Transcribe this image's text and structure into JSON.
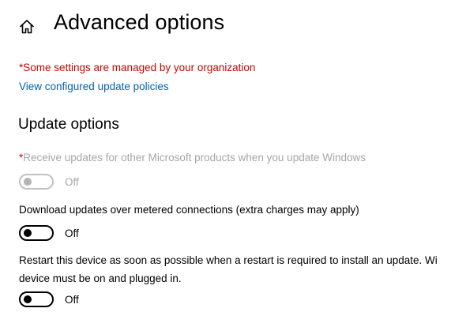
{
  "header": {
    "title": "Advanced options",
    "home_icon": "home-icon"
  },
  "org_notice": {
    "text": "*Some settings are managed by your organization",
    "color": "#c50500"
  },
  "policies_link": {
    "label": "View configured update policies",
    "color": "#0063b1"
  },
  "update_options": {
    "title": "Update options",
    "options": [
      {
        "required_marker": "*",
        "label": "Receive updates for other Microsoft products when you update Windows",
        "state": "Off",
        "enabled": false
      },
      {
        "label": "Download updates over metered connections (extra charges may apply)",
        "state": "Off",
        "enabled": true
      },
      {
        "label": "Restart this device as soon as possible when a restart is required to install an update. Wi",
        "label_line2": "device must be on and plugged in.",
        "state": "Off",
        "enabled": true
      }
    ]
  }
}
